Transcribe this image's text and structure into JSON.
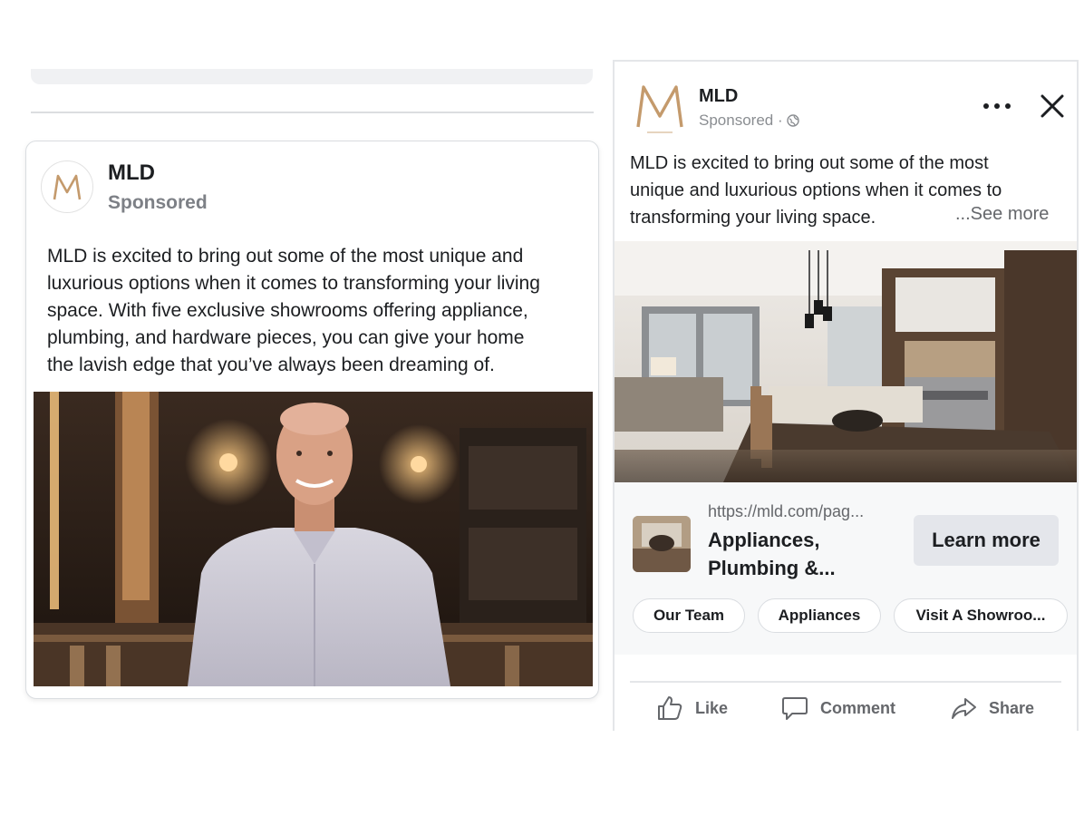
{
  "left_post": {
    "page_name": "MLD",
    "sponsored_label": "Sponsored",
    "logo_letter": "M",
    "body_lines": [
      "MLD is excited to bring out some of the most unique and",
      "luxurious options when it comes to transforming your living",
      "space. With five exclusive showrooms offering appliance,",
      "plumbing, and hardware pieces, you can give your home",
      "the lavish edge that you’ve always been dreaming of."
    ]
  },
  "right_post": {
    "page_name": "MLD",
    "sponsored_label": "Sponsored ·",
    "logo_letter": "M",
    "body_lines": [
      "MLD is excited to bring out some of the most",
      "unique and luxurious options when it comes to",
      "transforming your living space."
    ],
    "see_more_label": "...See more",
    "link": {
      "url": "https://mld.com/pag...",
      "title_lines": [
        "Appliances,",
        "Plumbing &..."
      ],
      "cta_label": "Learn more"
    },
    "chips": [
      "Our Team",
      "Appliances",
      "Visit A Showroo..."
    ],
    "actions": {
      "like": "Like",
      "comment": "Comment",
      "share": "Share"
    }
  },
  "colors": {
    "logo_gold": "#c49a6c",
    "secondary_text": "#65676b",
    "button_bg": "#e4e6eb"
  },
  "icons": {
    "menu": "more-horizontal-icon",
    "close": "close-icon",
    "audience": "globe-icon",
    "like": "thumbs-up-icon",
    "comment": "comment-bubble-icon",
    "share": "share-arrow-icon"
  }
}
